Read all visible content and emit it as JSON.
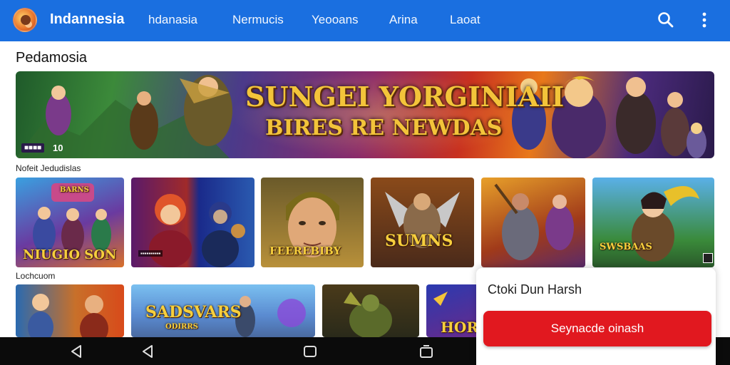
{
  "header": {
    "brand": "Indannesia",
    "nav": [
      "hdanasia",
      "Nermucis",
      "Yeooans",
      "Arina",
      "Laoat"
    ]
  },
  "featured": {
    "section_title": "Pedamosia",
    "banner": {
      "title_line1": "SUNGEI YORGINIAII",
      "title_line2": "BIRES RE NEWDAS",
      "badge": "■■■■",
      "badge_num": "10"
    }
  },
  "row1": {
    "title": "Nofeit Jedudislas",
    "tiles": [
      {
        "label": "NIUGIO SON",
        "top": "BARNS"
      },
      {
        "label": "",
        "sub": "▪▪▪▪▪▪▪▪▪▪"
      },
      {
        "label": "FEEREBIBY"
      },
      {
        "label": "SUMNS"
      },
      {
        "label": ""
      },
      {
        "label": "SWSBAAS"
      }
    ]
  },
  "row2": {
    "title": "Lochcuom",
    "tiles": [
      {
        "label": ""
      },
      {
        "label": "SADSVARS",
        "sub": "ODIRRS"
      },
      {
        "label": ""
      },
      {
        "label": "HOR"
      }
    ]
  },
  "popup": {
    "text": "Ctoki Dun Harsh",
    "button_label": "Seynacde oinash"
  },
  "colors": {
    "topbar": "#1a6fe0",
    "popup_button": "#e1181f",
    "android_bar": "#0b0b0b"
  }
}
